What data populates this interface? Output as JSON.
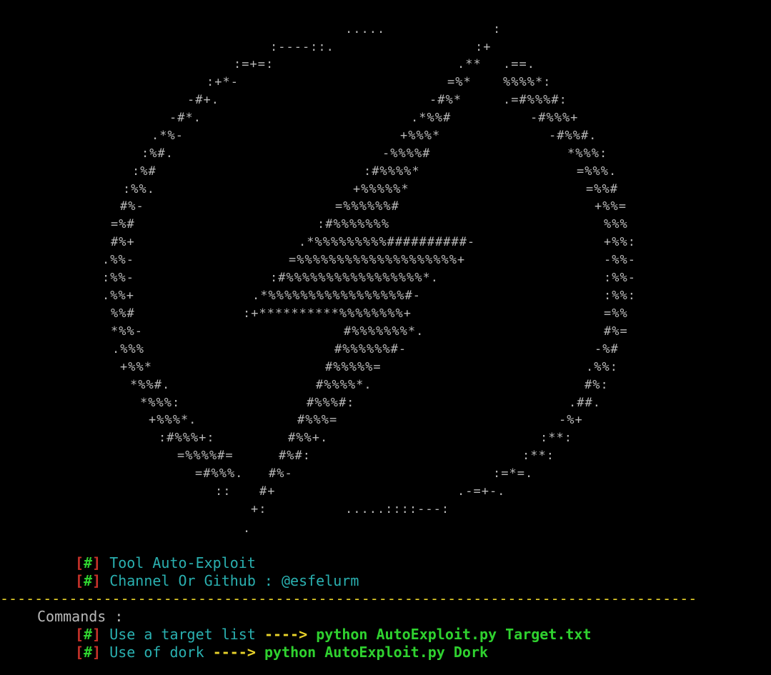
{
  "ascii_art": [
    ".....",
    ":",
    ":----::.",
    ":+",
    ":=+=:",
    ".**",
    ".==.",
    ":+*-",
    "=%*",
    "%%%%*:",
    "-#+.",
    "-#%*",
    ".=#%%%#:",
    "-#*.",
    ".*%%#",
    "-#%%%+",
    ".*%-",
    "+%%%*",
    "-#%%#.",
    ":%#.",
    "-%%%%#",
    "*%%%:",
    ":%#",
    ":#%%%%*",
    "=%%%.",
    ":%%.",
    "+%%%%%*",
    "=%%#",
    "#%-",
    "=%%%%%%#",
    "+%%=",
    "=%#",
    ":#%%%%%%%",
    "%%%",
    "#%+",
    ".*%%%%%%%%%##########-",
    "+%%:",
    ".%%-",
    "=%%%%%%%%%%%%%%%%%%%%+",
    "-%%-",
    ":%%-",
    ":#%%%%%%%%%%%%%%%%%*.",
    ":%%-",
    ".%%+",
    ".*%%%%%%%%%%%%%%%%%#-",
    ":%%:",
    "%%#",
    ":+**********%%%%%%%%+",
    "=%%",
    "*%%-",
    "#%%%%%%%*.",
    "#%=",
    ".%%%",
    "#%%%%%%#-",
    "-%#",
    "+%%*",
    "#%%%%%=",
    ".%%:",
    "*%%#.",
    "#%%%%*.",
    "#%:",
    "*%%%:",
    "#%%%#:",
    ".##.",
    "+%%%*.",
    "#%%%=",
    "-%+",
    ":#%%%+:",
    "#%%+.",
    ":**:",
    "=%%%%#=",
    "#%#:",
    ":**:",
    "=#%%%.",
    "#%-",
    ":=*=.",
    "::",
    "#+",
    ".-=+-.",
    "+:",
    ".....::::---:",
    "."
  ],
  "info": {
    "bracket_open": "[",
    "hash": "#",
    "bracket_close": "]",
    "line1": "Tool Auto-Exploit",
    "line2": "Channel Or Github : @esfelurm"
  },
  "separator": "----------------------------------------------------------------------------------------------------",
  "commands": {
    "header": "Commands :",
    "items": [
      {
        "label": "Use a target list",
        "arrow": "---->",
        "cmd": "python AutoExploit.py Target.txt"
      },
      {
        "label": "Use of dork",
        "arrow": "---->",
        "cmd": "python AutoExploit.py Dork"
      }
    ]
  },
  "colors": {
    "background": "#000000",
    "art": "#b9b9b9",
    "bracket": "#c8322a",
    "hash": "#2fd12f",
    "label": "#2ab0b0",
    "arrow": "#e8d22a",
    "command": "#2fd12f"
  }
}
